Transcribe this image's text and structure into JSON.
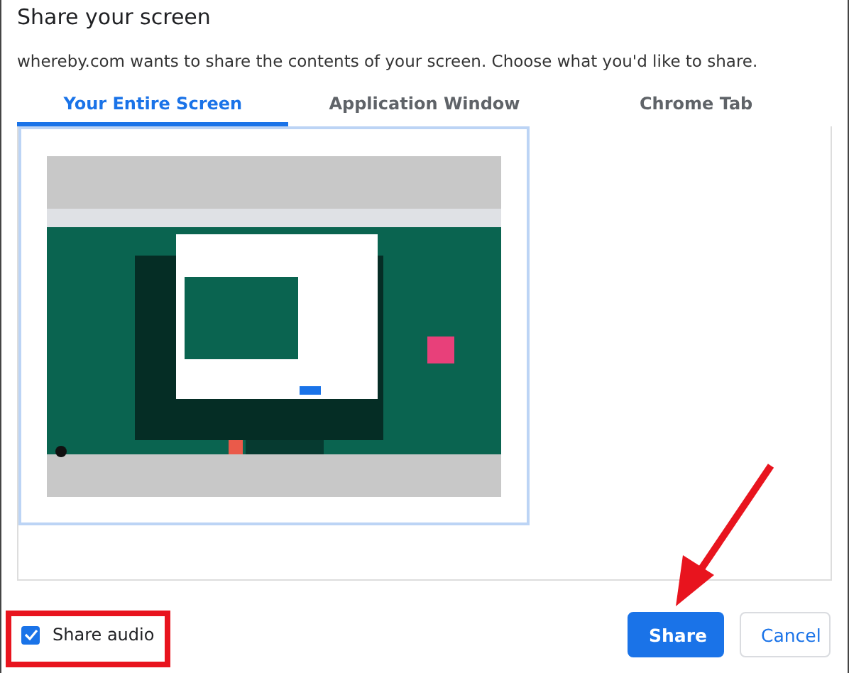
{
  "dialog": {
    "title": "Share your screen",
    "message": "whereby.com wants to share the contents of your screen. Choose what you'd like to share.",
    "tabs": [
      {
        "label": "Your Entire Screen",
        "selected": true
      },
      {
        "label": "Application Window",
        "selected": false
      },
      {
        "label": "Chrome Tab",
        "selected": false
      }
    ],
    "sources": [
      {
        "kind": "picture",
        "selected": true
      }
    ],
    "share_audio": {
      "label": "Share audio",
      "checked": true
    },
    "buttons": [
      {
        "label": "Share",
        "kind": "primary"
      },
      {
        "label": "Cancel",
        "kind": "secondary"
      }
    ]
  },
  "annotations": {
    "frame": true,
    "arrow": true
  }
}
